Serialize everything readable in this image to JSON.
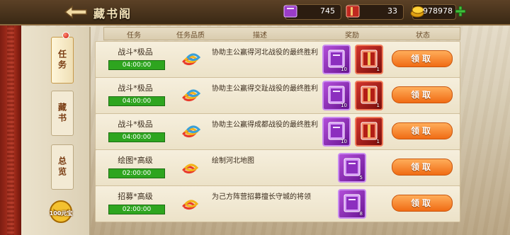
{
  "header": {
    "title": "藏书阁"
  },
  "resources": {
    "books": {
      "icon": "purple-book-icon",
      "value": "745"
    },
    "scrolls": {
      "icon": "red-scroll-icon",
      "value": "33"
    },
    "gold": {
      "icon": "gold-coin-icon",
      "value": "978978"
    }
  },
  "side_tabs": [
    {
      "label": "任务",
      "active": true
    },
    {
      "label": "藏书",
      "active": false
    },
    {
      "label": "总览",
      "active": false
    }
  ],
  "yuanbao_badge": "100元宝",
  "columns": [
    "任务",
    "任务品质",
    "描述",
    "奖励",
    "状态"
  ],
  "tasks": [
    {
      "name": "战斗*极品",
      "timer": "04:00:00",
      "quality": "tier-3",
      "desc": "协助主公赢得河北战役的最终胜利",
      "rewards": [
        {
          "type": "purple",
          "icon": "purple-book-icon",
          "count": "10"
        },
        {
          "type": "red",
          "icon": "red-scroll-icon",
          "count": "1"
        }
      ],
      "action": "领取"
    },
    {
      "name": "战斗*极品",
      "timer": "04:00:00",
      "quality": "tier-3",
      "desc": "协助主公赢得交趾战役的最终胜利",
      "rewards": [
        {
          "type": "purple",
          "icon": "purple-book-icon",
          "count": "10"
        },
        {
          "type": "red",
          "icon": "red-scroll-icon",
          "count": "1"
        }
      ],
      "action": "领取"
    },
    {
      "name": "战斗*极品",
      "timer": "04:00:00",
      "quality": "tier-3",
      "desc": "协助主公赢得成都战役的最终胜利",
      "rewards": [
        {
          "type": "purple",
          "icon": "purple-book-icon",
          "count": "10"
        },
        {
          "type": "red",
          "icon": "red-scroll-icon",
          "count": "1"
        }
      ],
      "action": "领取"
    },
    {
      "name": "绘图*高级",
      "timer": "02:00:00",
      "quality": "tier-2",
      "desc": "绘制河北地图",
      "rewards": [
        {
          "type": "purple",
          "icon": "purple-book-icon",
          "count": "5"
        }
      ],
      "action": "领取"
    },
    {
      "name": "招募*高级",
      "timer": "02:00:00",
      "quality": "tier-2",
      "desc": "为己方阵营招募擅长守城的将领",
      "rewards": [
        {
          "type": "purple",
          "icon": "purple-book-icon",
          "count": "8"
        }
      ],
      "action": "领取"
    }
  ]
}
